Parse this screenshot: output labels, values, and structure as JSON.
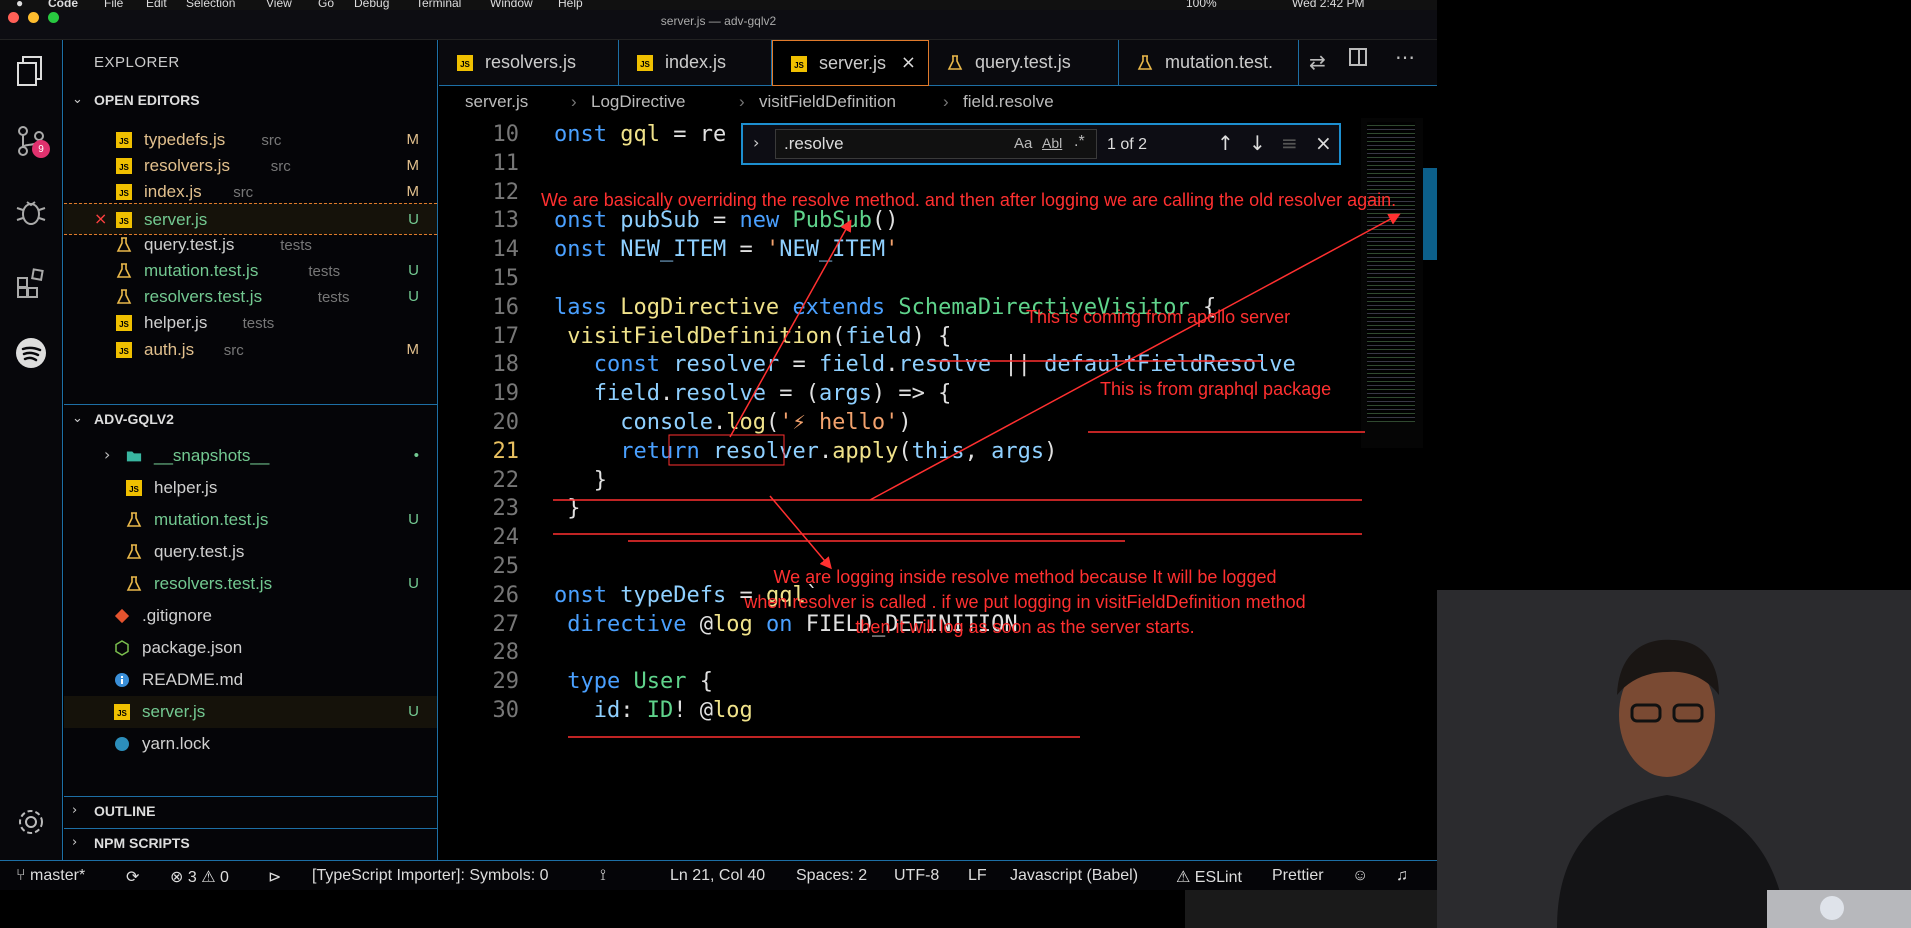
{
  "menubar": {
    "app": "Code",
    "items": [
      "File",
      "Edit",
      "Selection",
      "View",
      "Go",
      "Debug",
      "Terminal",
      "Window",
      "Help"
    ],
    "battery": "100%",
    "clock": "Wed 2:42 PM"
  },
  "window_title": "server.js — adv-gqlv2",
  "activity": {
    "scm_badge": "9",
    "icons": [
      "explorer-icon",
      "source-control-icon",
      "debug-icon",
      "extensions-icon",
      "spotify-icon",
      "settings-icon"
    ]
  },
  "sidebar": {
    "title": "EXPLORER",
    "open_editors_label": "OPEN EDITORS",
    "open_editors": [
      {
        "name": "typedefs.js",
        "dir": "src",
        "status": "M",
        "icon": "js",
        "color": "#e2c08d"
      },
      {
        "name": "resolvers.js",
        "dir": "src",
        "status": "M",
        "icon": "js",
        "color": "#e2c08d"
      },
      {
        "name": "index.js",
        "dir": "src",
        "status": "M",
        "icon": "js",
        "color": "#e2c08d"
      },
      {
        "name": "server.js",
        "dir": "",
        "status": "U",
        "icon": "js",
        "color": "#73c991"
      },
      {
        "name": "query.test.js",
        "dir": "tests",
        "status": "",
        "icon": "flask",
        "color": "#d0d0d0"
      },
      {
        "name": "mutation.test.js",
        "dir": "tests",
        "status": "U",
        "icon": "flask",
        "color": "#73c991"
      },
      {
        "name": "resolvers.test.js",
        "dir": "tests",
        "status": "U",
        "icon": "flask",
        "color": "#73c991"
      },
      {
        "name": "helper.js",
        "dir": "tests",
        "status": "",
        "icon": "js",
        "color": "#d0d0d0"
      },
      {
        "name": "auth.js",
        "dir": "src",
        "status": "M",
        "icon": "js",
        "color": "#e2c08d"
      }
    ],
    "project_label": "ADV-GQLV2",
    "project_files": [
      {
        "name": "__snapshots__",
        "status": "•",
        "icon": "folder",
        "color": "#73c991"
      },
      {
        "name": "helper.js",
        "status": "",
        "icon": "js",
        "color": "#d0d0d0"
      },
      {
        "name": "mutation.test.js",
        "status": "U",
        "icon": "flask",
        "color": "#73c991"
      },
      {
        "name": "query.test.js",
        "status": "",
        "icon": "flask",
        "color": "#d0d0d0"
      },
      {
        "name": "resolvers.test.js",
        "status": "U",
        "icon": "flask",
        "color": "#73c991"
      },
      {
        "name": ".gitignore",
        "status": "",
        "icon": "git",
        "color": "#d0d0d0"
      },
      {
        "name": "package.json",
        "status": "",
        "icon": "node",
        "color": "#d0d0d0"
      },
      {
        "name": "README.md",
        "status": "",
        "icon": "info",
        "color": "#d0d0d0"
      },
      {
        "name": "server.js",
        "status": "U",
        "icon": "js",
        "color": "#73c991"
      },
      {
        "name": "yarn.lock",
        "status": "",
        "icon": "yarn",
        "color": "#d0d0d0"
      }
    ],
    "outline_label": "OUTLINE",
    "npm_label": "NPM SCRIPTS"
  },
  "tabs": [
    {
      "name": "resolvers.js",
      "icon": "js"
    },
    {
      "name": "index.js",
      "icon": "js"
    },
    {
      "name": "server.js",
      "icon": "js",
      "active": true
    },
    {
      "name": "query.test.js",
      "icon": "flask"
    },
    {
      "name": "mutation.test.",
      "icon": "flask"
    }
  ],
  "breadcrumb": [
    "server.js",
    "LogDirective",
    "visitFieldDefinition",
    "field.resolve"
  ],
  "find": {
    "query": ".resolve",
    "match_case": "Aa",
    "whole_word": "Abl",
    "regex": ".*",
    "result": "1 of 2"
  },
  "code_lines": [
    {
      "n": "10",
      "text": "onst gql = re"
    },
    {
      "n": "11",
      "text": ""
    },
    {
      "n": "12",
      "text": ""
    },
    {
      "n": "13",
      "text": "onst pubSub = new PubSub()"
    },
    {
      "n": "14",
      "text": "onst NEW_ITEM = 'NEW_ITEM'"
    },
    {
      "n": "15",
      "text": ""
    },
    {
      "n": "16",
      "text": "lass LogDirective extends SchemaDirectiveVisitor {"
    },
    {
      "n": "17",
      "text": " visitFieldDefinition(field) {"
    },
    {
      "n": "18",
      "text": "   const resolver = field.resolve || defaultFieldResolve"
    },
    {
      "n": "19",
      "text": "   field.resolve = (args) => {"
    },
    {
      "n": "20",
      "text": "     console.log('⚡ hello')"
    },
    {
      "n": "21",
      "text": "     return resolver.apply(this, args)"
    },
    {
      "n": "22",
      "text": "   }"
    },
    {
      "n": "23",
      "text": " }"
    },
    {
      "n": "24",
      "text": ""
    },
    {
      "n": "25",
      "text": ""
    },
    {
      "n": "26",
      "text": "onst typeDefs = gql`"
    },
    {
      "n": "27",
      "text": " directive @log on FIELD_DEFINITION"
    },
    {
      "n": "28",
      "text": ""
    },
    {
      "n": "29",
      "text": " type User {"
    },
    {
      "n": "30",
      "text": "   id: ID! @log"
    }
  ],
  "annotations": {
    "a1": "We are basically overriding the resolve method. and then after logging we are calling the old resolver again.",
    "a2": "This is coming from apollo server",
    "a3": "This is from graphql package",
    "a4": "We are logging inside resolve method because It will be logged\nwhen resolver is called . if we put logging in visitFieldDefinition method\nthen it will log as soon as the server starts."
  },
  "status": {
    "branch": "master*",
    "errors": "3",
    "warnings": "0",
    "importer": "[TypeScript Importer]: Symbols: 0",
    "position": "Ln 21, Col 40",
    "spaces": "Spaces: 2",
    "encoding": "UTF-8",
    "eol": "LF",
    "language": "Javascript (Babel)",
    "eslint": "ESLint",
    "prettier": "Prettier"
  }
}
